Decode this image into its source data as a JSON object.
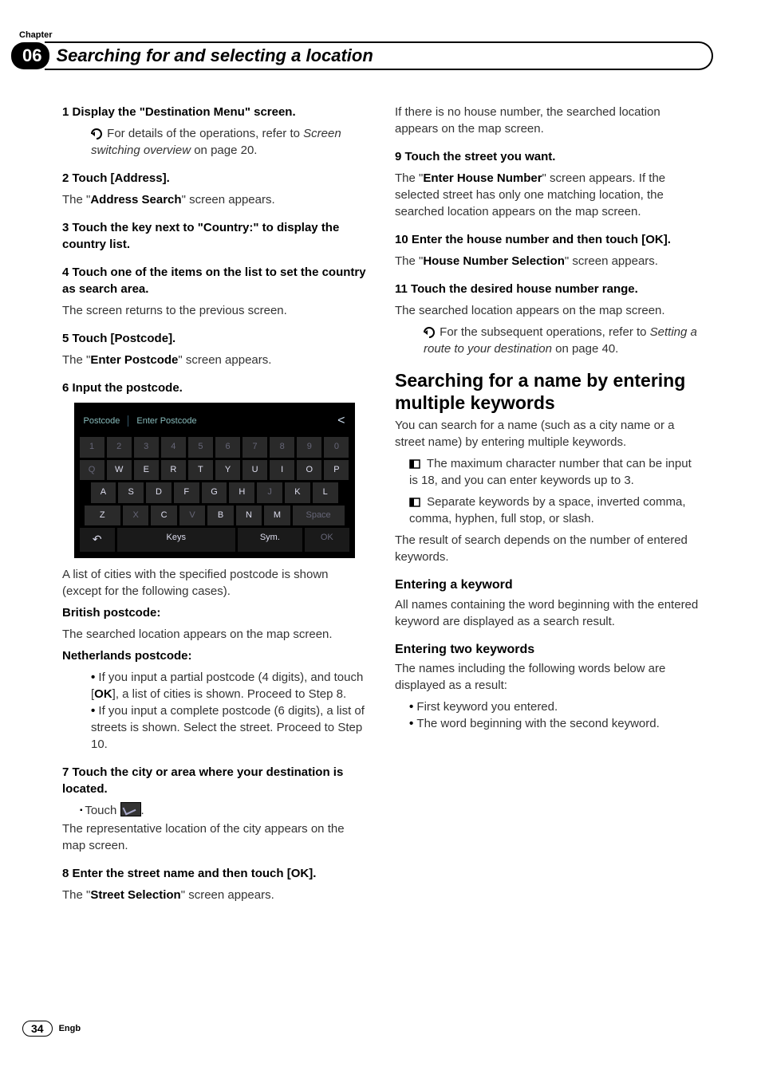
{
  "chapter_label": "Chapter",
  "chapter_number": "06",
  "chapter_title": "Searching for and selecting a location",
  "page_number": "34",
  "lang": "Engb",
  "left": {
    "s1_head": "1   Display the \"Destination Menu\" screen.",
    "s1_refer_pre": "For details of the operations, refer to ",
    "s1_refer_italic": "Screen switching overview",
    "s1_refer_post": " on page 20.",
    "s2_head": "2   Touch [Address].",
    "s2_body_pre": "The \"",
    "s2_body_bold": "Address Search",
    "s2_body_post": "\" screen appears.",
    "s3_head": "3   Touch the key next to \"Country:\" to display the country list.",
    "s4_head": "4   Touch one of the items on the list to set the country as search area.",
    "s4_body": "The screen returns to the previous screen.",
    "s5_head": "5   Touch [Postcode].",
    "s5_body_pre": "The \"",
    "s5_body_bold": "Enter Postcode",
    "s5_body_post": "\" screen appears.",
    "s6_head": "6   Input the postcode.",
    "after_kbd_1": "A list of cities with the specified postcode is shown (except for the following cases).",
    "british_head": "British postcode:",
    "british_body": "The searched location appears on the map screen.",
    "neth_head": "Netherlands postcode:",
    "neth_b1_pre": "If you input a partial postcode (4 digits), and touch [",
    "neth_b1_bold": "OK",
    "neth_b1_post": "], a list of cities is shown. Proceed to Step 8.",
    "neth_b2": "If you input a complete postcode (6 digits), a list of streets is shown. Select the street. Proceed to Step 10.",
    "s7_head": "7   Touch the city or area where your destination is located.",
    "s7_touch_label": "Touch ",
    "s7_touch_post": ".",
    "s7_body": "The representative location of the city appears on the map screen.",
    "s8_head": "8   Enter the street name and then touch [OK].",
    "s8_body_pre": "The \"",
    "s8_body_bold": "Street Selection",
    "s8_body_post": "\" screen appears."
  },
  "right": {
    "intro": "If there is no house number, the searched location appears on the map screen.",
    "s9_head": "9   Touch the street you want.",
    "s9_body_pre": "The \"",
    "s9_body_bold": "Enter House Number",
    "s9_body_post": "\" screen appears. If the selected street has only one matching location, the searched location appears on the map screen.",
    "s10_head": "10  Enter the house number and then touch [OK].",
    "s10_body_pre": "The \"",
    "s10_body_bold": "House Number Selection",
    "s10_body_post": "\" screen appears.",
    "s11_head": "11  Touch the desired house number range.",
    "s11_body": "The searched location appears on the map screen.",
    "s11_refer_pre": "For the subsequent operations, refer to ",
    "s11_refer_italic": "Setting a route to your destination",
    "s11_refer_post": " on page 40.",
    "h2": "Searching for a name by entering multiple keywords",
    "h2_body": "You can search for a name (such as a city name or a street name) by entering multiple keywords.",
    "bx1": "The maximum character number that can be input is 18, and you can enter keywords up to 3.",
    "bx2": "Separate keywords by a space, inverted comma, comma, hyphen, full stop, or slash.",
    "h2_after": "The result of search depends on the number of entered keywords.",
    "h3a": "Entering a keyword",
    "h3a_body": "All names containing the word beginning with the entered keyword are displayed as a search result.",
    "h3b": "Entering two keywords",
    "h3b_body": "The names including the following words below are displayed as a result:",
    "h3b_b1": "First keyword you entered.",
    "h3b_b2": "The word beginning with the second keyword."
  },
  "kbd": {
    "label": "Postcode",
    "placeholder": "Enter Postcode",
    "back": "<",
    "row1": [
      "1",
      "2",
      "3",
      "4",
      "5",
      "6",
      "7",
      "8",
      "9",
      "0"
    ],
    "row2": [
      "Q",
      "W",
      "E",
      "R",
      "T",
      "Y",
      "U",
      "I",
      "O",
      "P"
    ],
    "row3": [
      "A",
      "S",
      "D",
      "F",
      "G",
      "H",
      "J",
      "K",
      "L"
    ],
    "row4_left": "Z",
    "row4": [
      "X",
      "C",
      "V",
      "B",
      "N",
      "M"
    ],
    "row4_right": "Space",
    "bot_back": "↶",
    "bot_keys": "Keys",
    "bot_sym": "Sym.",
    "bot_ok": "OK"
  }
}
